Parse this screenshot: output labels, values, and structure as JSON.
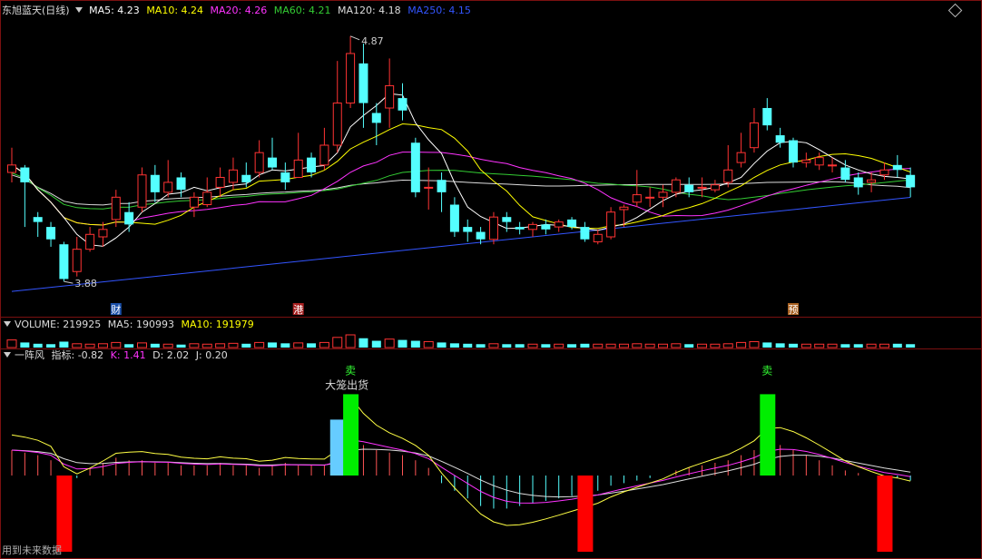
{
  "header": {
    "stock": "东旭蓝天(日线)",
    "ma": [
      {
        "label": "MA5: 4.23",
        "color": "#ffffff"
      },
      {
        "label": "MA10: 4.24",
        "color": "#ffff00"
      },
      {
        "label": "MA20: 4.26",
        "color": "#ff33ff"
      },
      {
        "label": "MA60: 4.21",
        "color": "#33cc33"
      },
      {
        "label": "MA120: 4.18",
        "color": "#dddddd"
      },
      {
        "label": "MA250: 4.15",
        "color": "#3355ff"
      }
    ]
  },
  "volume_header": [
    {
      "label": "VOLUME: 219925",
      "color": "#dddddd"
    },
    {
      "label": "MA5: 190993",
      "color": "#dddddd"
    },
    {
      "label": "MA10: 191979",
      "color": "#ffff00"
    }
  ],
  "indicator_header": [
    {
      "label": "一阵风",
      "color": "#dddddd"
    },
    {
      "label": "指标: -0.82",
      "color": "#dddddd"
    },
    {
      "label": "K: 1.41",
      "color": "#ff33ff"
    },
    {
      "label": "D: 2.02",
      "color": "#dddddd"
    },
    {
      "label": "J: 0.20",
      "color": "#dddddd"
    }
  ],
  "chart_data": {
    "type": "candlestick",
    "y_range": [
      3.8,
      4.95
    ],
    "annotations": {
      "high_label": "4.87",
      "low_label": "3.88"
    },
    "event_markers": [
      "财",
      "港",
      "预"
    ],
    "candles": [
      [
        4.32,
        4.35,
        4.42,
        4.28
      ],
      [
        4.34,
        4.28,
        4.35,
        4.1
      ],
      [
        4.14,
        4.12,
        4.16,
        4.06
      ],
      [
        4.1,
        4.05,
        4.12,
        4.02
      ],
      [
        4.03,
        3.89,
        4.04,
        3.88
      ],
      [
        3.92,
        4.01,
        4.06,
        3.9
      ],
      [
        4.01,
        4.07,
        4.1,
        4.0
      ],
      [
        4.06,
        4.09,
        4.12,
        4.02
      ],
      [
        4.13,
        4.22,
        4.25,
        4.1
      ],
      [
        4.16,
        4.11,
        4.2,
        4.08
      ],
      [
        4.18,
        4.31,
        4.34,
        4.16
      ],
      [
        4.31,
        4.24,
        4.35,
        4.2
      ],
      [
        4.24,
        4.28,
        4.37,
        4.22
      ],
      [
        4.3,
        4.25,
        4.32,
        4.22
      ],
      [
        4.18,
        4.22,
        4.24,
        4.14
      ],
      [
        4.19,
        4.24,
        4.3,
        4.18
      ],
      [
        4.26,
        4.3,
        4.34,
        4.22
      ],
      [
        4.28,
        4.33,
        4.38,
        4.25
      ],
      [
        4.31,
        4.28,
        4.36,
        4.26
      ],
      [
        4.32,
        4.4,
        4.45,
        4.3
      ],
      [
        4.38,
        4.34,
        4.46,
        4.33
      ],
      [
        4.32,
        4.28,
        4.36,
        4.25
      ],
      [
        4.3,
        4.37,
        4.48,
        4.3
      ],
      [
        4.38,
        4.32,
        4.4,
        4.3
      ],
      [
        4.35,
        4.43,
        4.5,
        4.33
      ],
      [
        4.43,
        4.6,
        4.77,
        4.4
      ],
      [
        4.6,
        4.8,
        4.87,
        4.58
      ],
      [
        4.76,
        4.6,
        4.84,
        4.5
      ],
      [
        4.56,
        4.52,
        4.6,
        4.43
      ],
      [
        4.58,
        4.67,
        4.78,
        4.5
      ],
      [
        4.62,
        4.57,
        4.68,
        4.53
      ],
      [
        4.44,
        4.24,
        4.46,
        4.22
      ],
      [
        4.26,
        4.26,
        4.34,
        4.17
      ],
      [
        4.29,
        4.24,
        4.32,
        4.16
      ],
      [
        4.19,
        4.08,
        4.22,
        4.06
      ],
      [
        4.1,
        4.08,
        4.13,
        4.04
      ],
      [
        4.08,
        4.05,
        4.1,
        4.03
      ],
      [
        4.05,
        4.14,
        4.16,
        4.03
      ],
      [
        4.14,
        4.12,
        4.16,
        4.08
      ],
      [
        4.1,
        4.09,
        4.12,
        4.07
      ],
      [
        4.09,
        4.11,
        4.12,
        4.06
      ],
      [
        4.11,
        4.09,
        4.13,
        4.07
      ],
      [
        4.1,
        4.12,
        4.13,
        4.08
      ],
      [
        4.13,
        4.1,
        4.14,
        4.09
      ],
      [
        4.1,
        4.05,
        4.12,
        4.04
      ],
      [
        4.04,
        4.07,
        4.09,
        4.03
      ],
      [
        4.06,
        4.16,
        4.18,
        4.05
      ],
      [
        4.17,
        4.18,
        4.19,
        4.1
      ],
      [
        4.2,
        4.23,
        4.33,
        4.18
      ],
      [
        4.22,
        4.22,
        4.26,
        4.18
      ],
      [
        4.22,
        4.24,
        4.27,
        4.18
      ],
      [
        4.24,
        4.29,
        4.3,
        4.22
      ],
      [
        4.27,
        4.24,
        4.3,
        4.22
      ],
      [
        4.26,
        4.26,
        4.3,
        4.22
      ],
      [
        4.25,
        4.27,
        4.29,
        4.24
      ],
      [
        4.28,
        4.33,
        4.43,
        4.26
      ],
      [
        4.36,
        4.4,
        4.48,
        4.34
      ],
      [
        4.42,
        4.52,
        4.58,
        4.4
      ],
      [
        4.58,
        4.51,
        4.62,
        4.49
      ],
      [
        4.47,
        4.44,
        4.5,
        4.42
      ],
      [
        4.45,
        4.36,
        4.46,
        4.34
      ],
      [
        4.36,
        4.37,
        4.4,
        4.34
      ],
      [
        4.35,
        4.38,
        4.4,
        4.33
      ],
      [
        4.35,
        4.35,
        4.38,
        4.32
      ],
      [
        4.34,
        4.29,
        4.37,
        4.28
      ],
      [
        4.3,
        4.26,
        4.32,
        4.23
      ],
      [
        4.28,
        4.29,
        4.32,
        4.24
      ],
      [
        4.31,
        4.33,
        4.36,
        4.29
      ],
      [
        4.35,
        4.33,
        4.39,
        4.3
      ],
      [
        4.31,
        4.26,
        4.34,
        4.22
      ]
    ],
    "ma_colors": {
      "ma5": "#ffffff",
      "ma10": "#ffff00",
      "ma20": "#ff33ff",
      "ma60": "#33cc33",
      "ma120": "#dddddd",
      "ma250": "#3355ff"
    },
    "volume": [
      18,
      12,
      9,
      8,
      14,
      9,
      8,
      9,
      12,
      8,
      11,
      9,
      8,
      7,
      9,
      8,
      9,
      10,
      9,
      12,
      12,
      10,
      11,
      10,
      12,
      24,
      30,
      22,
      16,
      20,
      18,
      16,
      14,
      12,
      10,
      9,
      8,
      9,
      8,
      8,
      8,
      8,
      8,
      8,
      9,
      8,
      8,
      8,
      9,
      8,
      8,
      9,
      8,
      8,
      8,
      9,
      12,
      14,
      12,
      10,
      9,
      8,
      8,
      8,
      8,
      8,
      8,
      8,
      9,
      8
    ],
    "indicator_bars": [
      10,
      9,
      8,
      6,
      -2,
      -1,
      3,
      5,
      7,
      6,
      6,
      5,
      5,
      4,
      4,
      4,
      5,
      4,
      4,
      3,
      4,
      5,
      4,
      4,
      4,
      8,
      30,
      12,
      10,
      9,
      8,
      6,
      3,
      -3,
      -6,
      -9,
      -12,
      -13,
      -13,
      -12,
      -11,
      -10,
      -9,
      -8,
      -7,
      -6,
      -4,
      -3,
      -2,
      -1,
      0,
      2,
      3,
      4,
      5,
      6,
      8,
      10,
      14,
      12,
      10,
      8,
      6,
      4,
      2,
      1,
      0,
      -1,
      -1,
      -2
    ],
    "signals": [
      {
        "bar": 4,
        "type": "buy",
        "value": -30
      },
      {
        "bar": 25,
        "type": "cyan",
        "value": 22
      },
      {
        "bar": 26,
        "type": "sell",
        "value": 32,
        "labels": [
          "卖",
          "大笼出货"
        ]
      },
      {
        "bar": 44,
        "type": "buy",
        "value": -30
      },
      {
        "bar": 58,
        "type": "sell",
        "value": 32,
        "labels": [
          "卖"
        ]
      },
      {
        "bar": 67,
        "type": "buy",
        "value": -30
      }
    ]
  },
  "footer": "用到未来数据"
}
